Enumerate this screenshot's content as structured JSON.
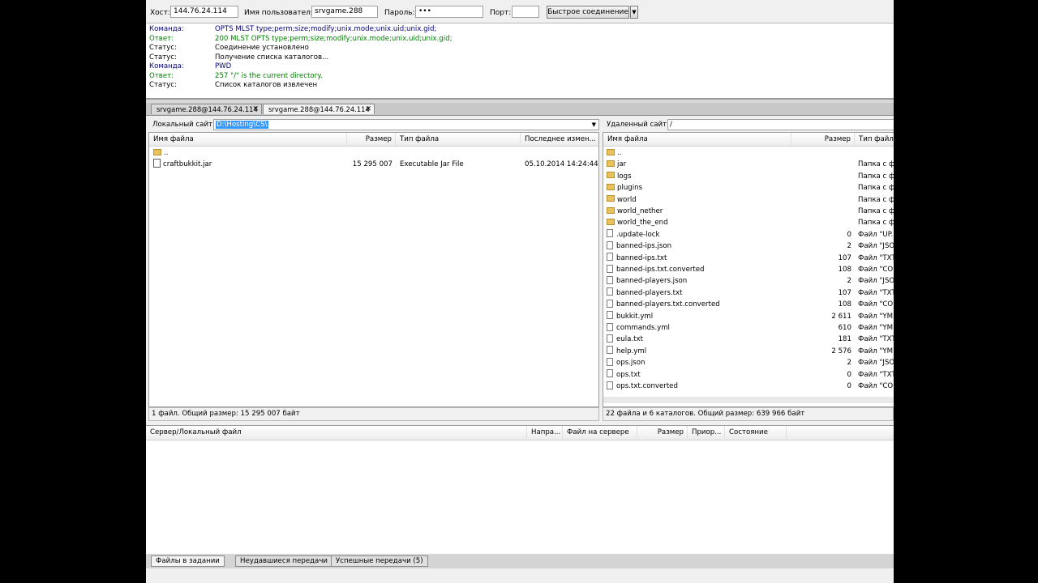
{
  "quickconnect": {
    "host_label": "Хост:",
    "host_value": "144.76.24.114",
    "user_label": "Имя пользователя",
    "user_value": "srvgame.288",
    "pass_label": "Пароль:",
    "pass_value": "•••",
    "port_label": "Порт:",
    "port_value": "",
    "connect_label": "Быстрое соединение",
    "dropdown_icon": "▼"
  },
  "log": [
    {
      "k": "Команда:",
      "v": "OPTS MLST type;perm;size;modify;unix.mode;unix.uid;unix.gid;",
      "kind": "cmd"
    },
    {
      "k": "Ответ:",
      "v": "200 MLST OPTS type;perm;size;modify;unix.mode;unix.uid;unix.gid;",
      "kind": "ans"
    },
    {
      "k": "Статус:",
      "v": "Соединение установлено",
      "kind": "sts"
    },
    {
      "k": "Статус:",
      "v": "Получение списка каталогов...",
      "kind": "sts"
    },
    {
      "k": "Команда:",
      "v": "PWD",
      "kind": "cmd"
    },
    {
      "k": "Ответ:",
      "v": "257 \"/\" is the current directory.",
      "kind": "ans"
    },
    {
      "k": "Статус:",
      "v": "Список каталогов извлечен",
      "kind": "sts"
    }
  ],
  "tabs": [
    {
      "label": "srvgame.288@144.76.24.114",
      "active": false
    },
    {
      "label": "srvgame.288@144.76.24.114",
      "active": true
    }
  ],
  "tab_close_icon": "✕",
  "local": {
    "site_label": "Локальный сайт:",
    "site_value": "D:\\Hosting\\CS\\",
    "dropdown_icon": "▼",
    "columns": [
      "Имя файла",
      "Размер",
      "Тип файла",
      "Последнее измен..."
    ],
    "rows": [
      {
        "name": "..",
        "size": "",
        "type": "",
        "modified": "",
        "icon": "folder"
      },
      {
        "name": "craftbukkit.jar",
        "size": "15 295 007",
        "type": "Executable Jar File",
        "modified": "05.10.2014 14:24:44",
        "icon": "jar"
      }
    ],
    "status": "1 файл. Общий размер: 15 295 007 байт"
  },
  "remote": {
    "site_label": "Удаленный сайт:",
    "site_value": "/",
    "columns": [
      "Имя файла",
      "Размер",
      "Тип файл"
    ],
    "rows": [
      {
        "name": "..",
        "size": "",
        "type": "",
        "icon": "folder"
      },
      {
        "name": "jar",
        "size": "",
        "type": "Папка с ф",
        "icon": "folder"
      },
      {
        "name": "logs",
        "size": "",
        "type": "Папка с ф",
        "icon": "folder"
      },
      {
        "name": "plugins",
        "size": "",
        "type": "Папка с ф",
        "icon": "folder"
      },
      {
        "name": "world",
        "size": "",
        "type": "Папка с ф",
        "icon": "folder"
      },
      {
        "name": "world_nether",
        "size": "",
        "type": "Папка с ф",
        "icon": "folder"
      },
      {
        "name": "world_the_end",
        "size": "",
        "type": "Папка с ф",
        "icon": "folder"
      },
      {
        "name": ".update-lock",
        "size": "0",
        "type": "Файл \"UP...",
        "icon": "file"
      },
      {
        "name": "banned-ips.json",
        "size": "2",
        "type": "Файл \"JSO",
        "icon": "file"
      },
      {
        "name": "banned-ips.txt",
        "size": "107",
        "type": "Файл \"TXT",
        "icon": "file"
      },
      {
        "name": "banned-ips.txt.converted",
        "size": "108",
        "type": "Файл \"CO",
        "icon": "file"
      },
      {
        "name": "banned-players.json",
        "size": "2",
        "type": "Файл \"JSO",
        "icon": "file"
      },
      {
        "name": "banned-players.txt",
        "size": "107",
        "type": "Файл \"TXT",
        "icon": "file"
      },
      {
        "name": "banned-players.txt.converted",
        "size": "108",
        "type": "Файл \"CO",
        "icon": "file"
      },
      {
        "name": "bukkit.yml",
        "size": "2 611",
        "type": "Файл \"YM",
        "icon": "file"
      },
      {
        "name": "commands.yml",
        "size": "610",
        "type": "Файл \"YM",
        "icon": "file"
      },
      {
        "name": "eula.txt",
        "size": "181",
        "type": "Файл \"TXT",
        "icon": "file"
      },
      {
        "name": "help.yml",
        "size": "2 576",
        "type": "Файл \"YM",
        "icon": "file"
      },
      {
        "name": "ops.json",
        "size": "2",
        "type": "Файл \"JSO",
        "icon": "file"
      },
      {
        "name": "ops.txt",
        "size": "0",
        "type": "Файл \"TXT",
        "icon": "file"
      },
      {
        "name": "ops.txt.converted",
        "size": "0",
        "type": "Файл \"CO",
        "icon": "file"
      }
    ],
    "status": "22 файла и 6 каталогов. Общий размер: 639 966 байт"
  },
  "queue": {
    "columns": [
      "Сервер/Локальный файл",
      "Напра...",
      "Файл на сервере",
      "Размер",
      "Приор...",
      "Состояние"
    ],
    "tabs": [
      {
        "label": "Файлы в задании",
        "active": true
      },
      {
        "label": "Неудавшиеся передачи",
        "active": false
      },
      {
        "label": "Успешные передачи (5)",
        "active": false
      }
    ]
  },
  "colors": {
    "command": "#00007f",
    "answer": "#007f00",
    "selection": "#3399ff"
  }
}
